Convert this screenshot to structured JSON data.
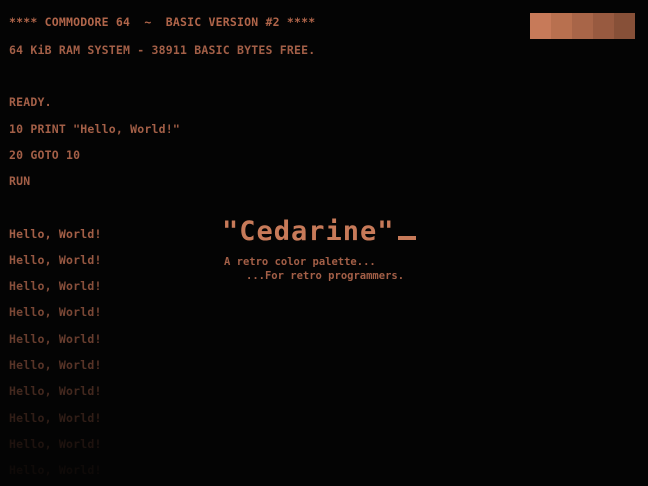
{
  "terminal": {
    "header": "**** COMMODORE 64  ~  BASIC VERSION #2 ****",
    "memory_line": "64 KiB RAM SYSTEM - 38911 BASIC BYTES FREE.",
    "ready": "READY.",
    "program_line_1": "10 PRINT \"Hello, World!\"",
    "program_line_2": "20 GOTO 10",
    "run_command": "RUN",
    "output_lines": [
      "Hello, World!",
      "Hello, World!",
      "Hello, World!",
      "Hello, World!",
      "Hello, World!",
      "Hello, World!",
      "Hello, World!",
      "Hello, World!",
      "Hello, World!",
      "Hello, World!"
    ]
  },
  "title": {
    "logo": "\"Cedarine\"",
    "tagline_1": "A retro color palette...",
    "tagline_2": "...For retro programmers."
  },
  "palette": {
    "swatches": [
      "#c77a59",
      "#b8704f",
      "#a86548",
      "#985a40",
      "#875038"
    ]
  },
  "colors": {
    "background": "#040404",
    "text": "#a35f47",
    "accent": "#c77a59"
  }
}
